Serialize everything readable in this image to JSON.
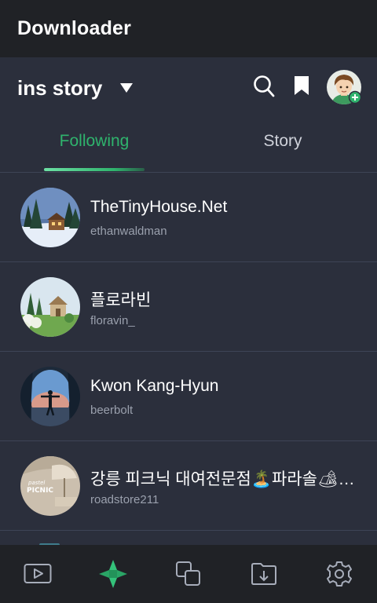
{
  "app": {
    "title": "Downloader"
  },
  "header": {
    "account_name": "ins story"
  },
  "icons": {
    "dropdown": "caret-down-icon",
    "search": "search-icon",
    "bookmark": "bookmark-icon",
    "avatar": "avatar-with-plus-badge"
  },
  "tabs": [
    {
      "label": "Following",
      "active": true
    },
    {
      "label": "Story",
      "active": false
    }
  ],
  "following": [
    {
      "name": "TheTinyHouse.Net",
      "handle": "ethanwaldman"
    },
    {
      "name": "플로라빈",
      "handle": "floravin_"
    },
    {
      "name": "Kwon Kang-Hyun",
      "handle": "beerbolt"
    },
    {
      "name": "강릉 피크닉 대여전문점🏝️파라솔🏕…",
      "handle": "roadstore211",
      "thumb_text": [
        "pastel",
        "PICNIC"
      ]
    }
  ],
  "bottom_nav": [
    {
      "icon": "video-play-icon",
      "active": false
    },
    {
      "icon": "app-logo-icon",
      "active": true
    },
    {
      "icon": "copy-icon",
      "active": false
    },
    {
      "icon": "folder-download-icon",
      "active": false
    },
    {
      "icon": "settings-gear-icon",
      "active": false
    }
  ],
  "colors": {
    "background": "#2b2f3c",
    "bar": "#202226",
    "accent": "#2fb36d",
    "divider": "#3e4456",
    "secondary_text": "#9aa0ad"
  }
}
